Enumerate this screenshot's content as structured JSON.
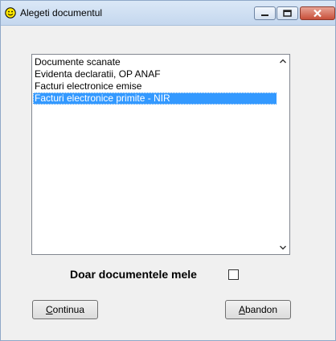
{
  "window": {
    "title": "Alegeti documentul",
    "icon": "smiley-icon"
  },
  "list": {
    "items": [
      {
        "label": "Documente scanate",
        "selected": false
      },
      {
        "label": "Evidenta declaratii, OP ANAF",
        "selected": false
      },
      {
        "label": "Facturi electronice emise",
        "selected": false
      },
      {
        "label": "Facturi electronice primite - NIR",
        "selected": true
      }
    ]
  },
  "filter": {
    "label": "Doar documentele mele",
    "checked": false
  },
  "buttons": {
    "continua": {
      "hotkey": "C",
      "rest": "ontinua"
    },
    "abandon": {
      "hotkey": "A",
      "rest": "bandon"
    }
  },
  "colors": {
    "selection": "#3399ff",
    "titlebar": "#c4d7ee",
    "close_button": "#c8503a"
  }
}
